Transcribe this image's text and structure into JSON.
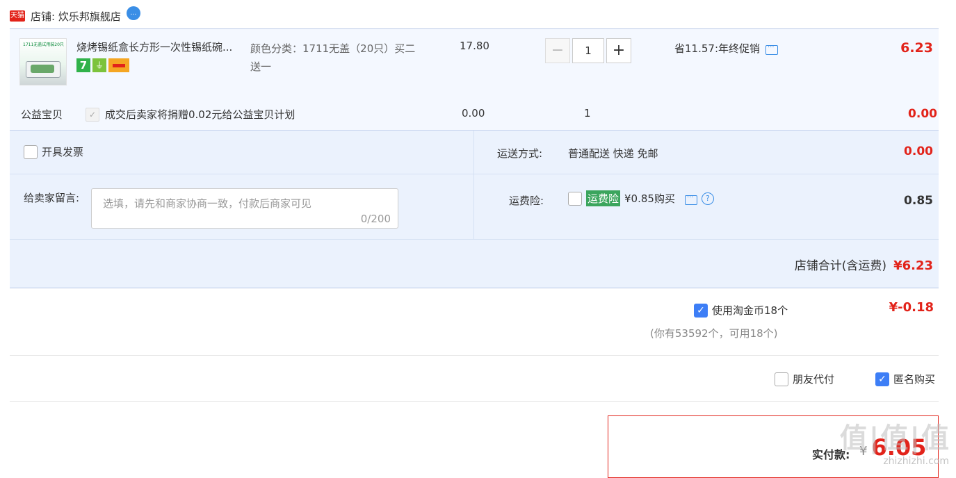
{
  "shop": {
    "badge": "天猫",
    "label": "店铺: 炊乐邦旗舰店",
    "chat_icon": "chat-bubble-icon"
  },
  "item": {
    "title": "烧烤锡纸盒长方形一次性锡纸碗...",
    "thumb_text": "1711无盖试用装20只",
    "badges": [
      "7",
      "plug",
      "card"
    ],
    "sku": "颜色分类：1711无盖（20只）买二送一",
    "unit_price": "17.80",
    "qty": "1",
    "minus": "−",
    "plus": "+",
    "promo": "省11.57:年终促销",
    "total": "6.23"
  },
  "charity": {
    "label": "公益宝贝",
    "text": "成交后卖家将捐赠0.02元给公益宝贝计划",
    "price": "0.00",
    "qty": "1",
    "total": "0.00"
  },
  "invoice": {
    "label": "开具发票"
  },
  "message": {
    "label": "给卖家留言:",
    "placeholder": "选填，请先和商家协商一致，付款后商家可见",
    "counter": "0/200"
  },
  "shipping": {
    "label": "运送方式:",
    "value": "普通配送 快递 免邮",
    "fee": "0.00"
  },
  "insurance": {
    "label": "运费险:",
    "tag": "运费险",
    "price": "¥0.85购买",
    "fee": "0.85"
  },
  "shop_total": {
    "label": "店铺合计(含运费)",
    "amount": "¥6.23"
  },
  "coins": {
    "label": "使用淘金币18个",
    "value": "¥-0.18",
    "sub": "(你有53592个，可用18个)"
  },
  "options": {
    "friend": "朋友代付",
    "anon": "匿名购买"
  },
  "pay": {
    "label": "实付款:",
    "currency": "¥",
    "amount": "6.05"
  },
  "watermark": {
    "text": "值|值|值",
    "sub": "zhizhizhi.com"
  },
  "colors": {
    "accent": "#e2231a",
    "checkbox": "#3d7ef6",
    "panel": "#ebf2fd"
  }
}
